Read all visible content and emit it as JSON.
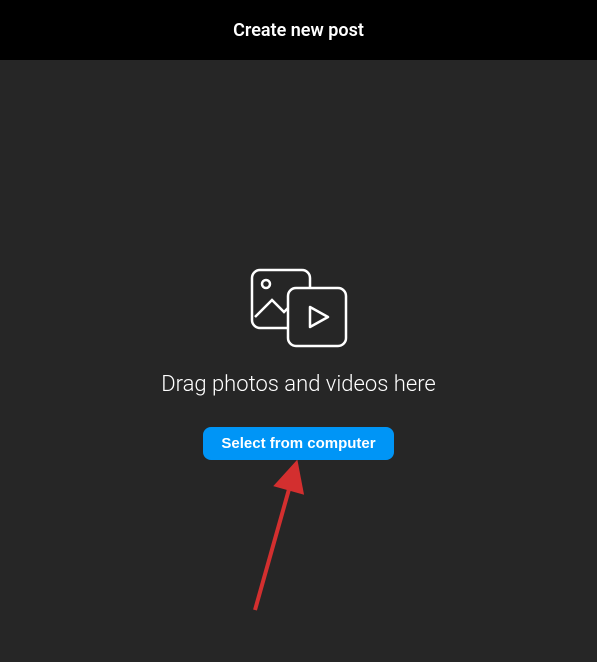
{
  "header": {
    "title": "Create new post"
  },
  "content": {
    "drop_text": "Drag photos and videos here",
    "button_label": "Select from computer"
  },
  "colors": {
    "accent": "#0095f6",
    "annotation": "#d32f2f"
  }
}
